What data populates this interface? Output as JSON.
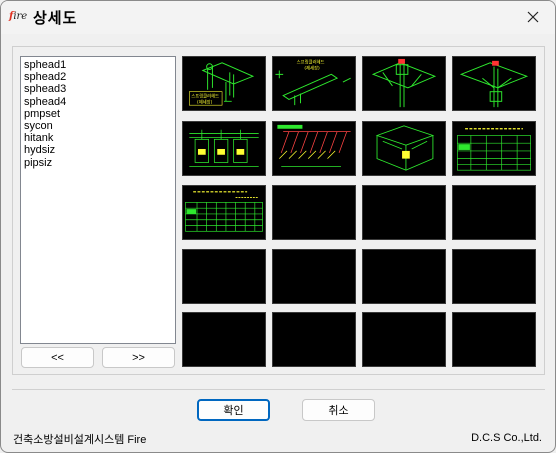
{
  "window": {
    "title": "상세도",
    "app_icon_text": "fire"
  },
  "list": {
    "items": [
      "sphead1",
      "sphead2",
      "sphead3",
      "sphead4",
      "pmpset",
      "sycon",
      "hitank",
      "hydsiz",
      "pipsiz"
    ]
  },
  "nav": {
    "prev_label": "<<",
    "next_label": ">>"
  },
  "thumbnails": {
    "count": 20,
    "labels": {
      "t1": "스프링클러헤드\n(제세장)",
      "t2": "스프링클러헤드\n(제세장)"
    }
  },
  "dialog": {
    "ok_label": "확인",
    "cancel_label": "취소"
  },
  "footer": {
    "left": "건축소방설비설계시스템 Fire",
    "right": "D.C.S Co.,Ltd."
  },
  "colors": {
    "drawing_line": "#2ee82e",
    "drawing_accent": "#ffff33",
    "thumb_bg": "#000000"
  }
}
